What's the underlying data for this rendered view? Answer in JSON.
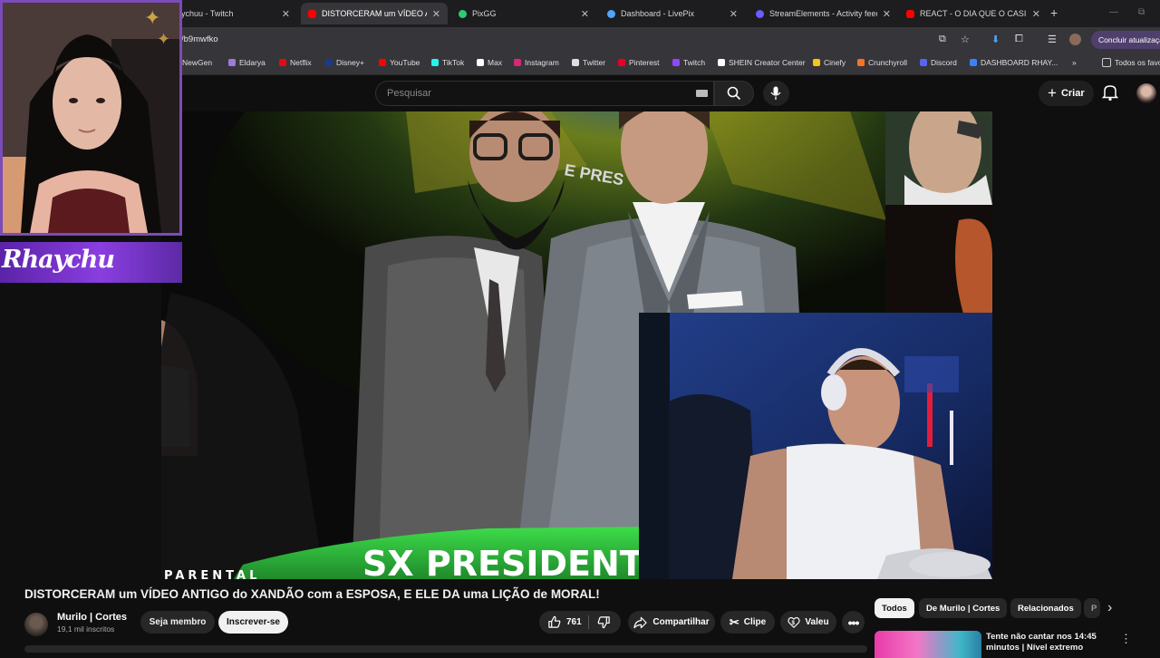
{
  "browser": {
    "tabs": [
      {
        "label": "ychuu - Twitch",
        "color": "#9146ff"
      },
      {
        "label": "DISTORCERAM um VÍDEO ANTIG",
        "color": "#ff0000",
        "active": true
      },
      {
        "label": "PixGG",
        "color": "#2ecc71"
      },
      {
        "label": "Dashboard - LivePix",
        "color": "#4ea6ff"
      },
      {
        "label": "StreamElements - Activity feed",
        "color": "#6b5cff"
      },
      {
        "label": "REACT - O DIA QUE O CASIMIR",
        "color": "#ff0000"
      }
    ],
    "url": "/b9mwfko",
    "update_button": "Concluir atualização",
    "bookmarks": [
      {
        "label": "NewGen",
        "color": "#e0b040"
      },
      {
        "label": "Eldarya",
        "color": "#9e7bd6"
      },
      {
        "label": "Netflix",
        "color": "#e50914"
      },
      {
        "label": "Disney+",
        "color": "#1a3a8f"
      },
      {
        "label": "YouTube",
        "color": "#ff0000"
      },
      {
        "label": "TikTok",
        "color": "#25f4ee"
      },
      {
        "label": "Max",
        "color": "#ffffff"
      },
      {
        "label": "Instagram",
        "color": "#d62976"
      },
      {
        "label": "Twitter",
        "color": "#dddddd"
      },
      {
        "label": "Pinterest",
        "color": "#e60023"
      },
      {
        "label": "Twitch",
        "color": "#9146ff"
      },
      {
        "label": "SHEIN Creator Center",
        "color": "#ffffff"
      },
      {
        "label": "Cinefy",
        "color": "#f5c518"
      },
      {
        "label": "Crunchyroll",
        "color": "#f47521"
      },
      {
        "label": "Discord",
        "color": "#5865f2"
      },
      {
        "label": "DASHBOARD RHAY...",
        "color": "#3b82f6"
      }
    ],
    "all_bookmarks": "Todos os favo"
  },
  "youtube": {
    "search_placeholder": "Pesquisar",
    "create_label": "Criar"
  },
  "video": {
    "banner_text": "SX PRESIDENT",
    "corner_text": "PARENTAL",
    "inset_text": "E PRES"
  },
  "overlay": {
    "brand": "Rhaychu"
  },
  "watch": {
    "title": "DISTORCERAM um VÍDEO ANTIGO do XANDÃO com a ESPOSA, E ELE DA uma LIÇÃO de MORAL!",
    "channel": "Murilo | Cortes",
    "subscribers": "19,1 mil inscritos",
    "join_label": "Seja membro",
    "subscribe_label": "Inscrever-se",
    "likes": "761",
    "share_label": "Compartilhar",
    "clip_label": "Clipe",
    "thanks_label": "Valeu"
  },
  "sidebar": {
    "chips": [
      "Todos",
      "De Murilo | Cortes",
      "Relacionados",
      "P"
    ],
    "rec_title": "Tente não cantar nos 14:45 minutos | Nível extremo"
  }
}
